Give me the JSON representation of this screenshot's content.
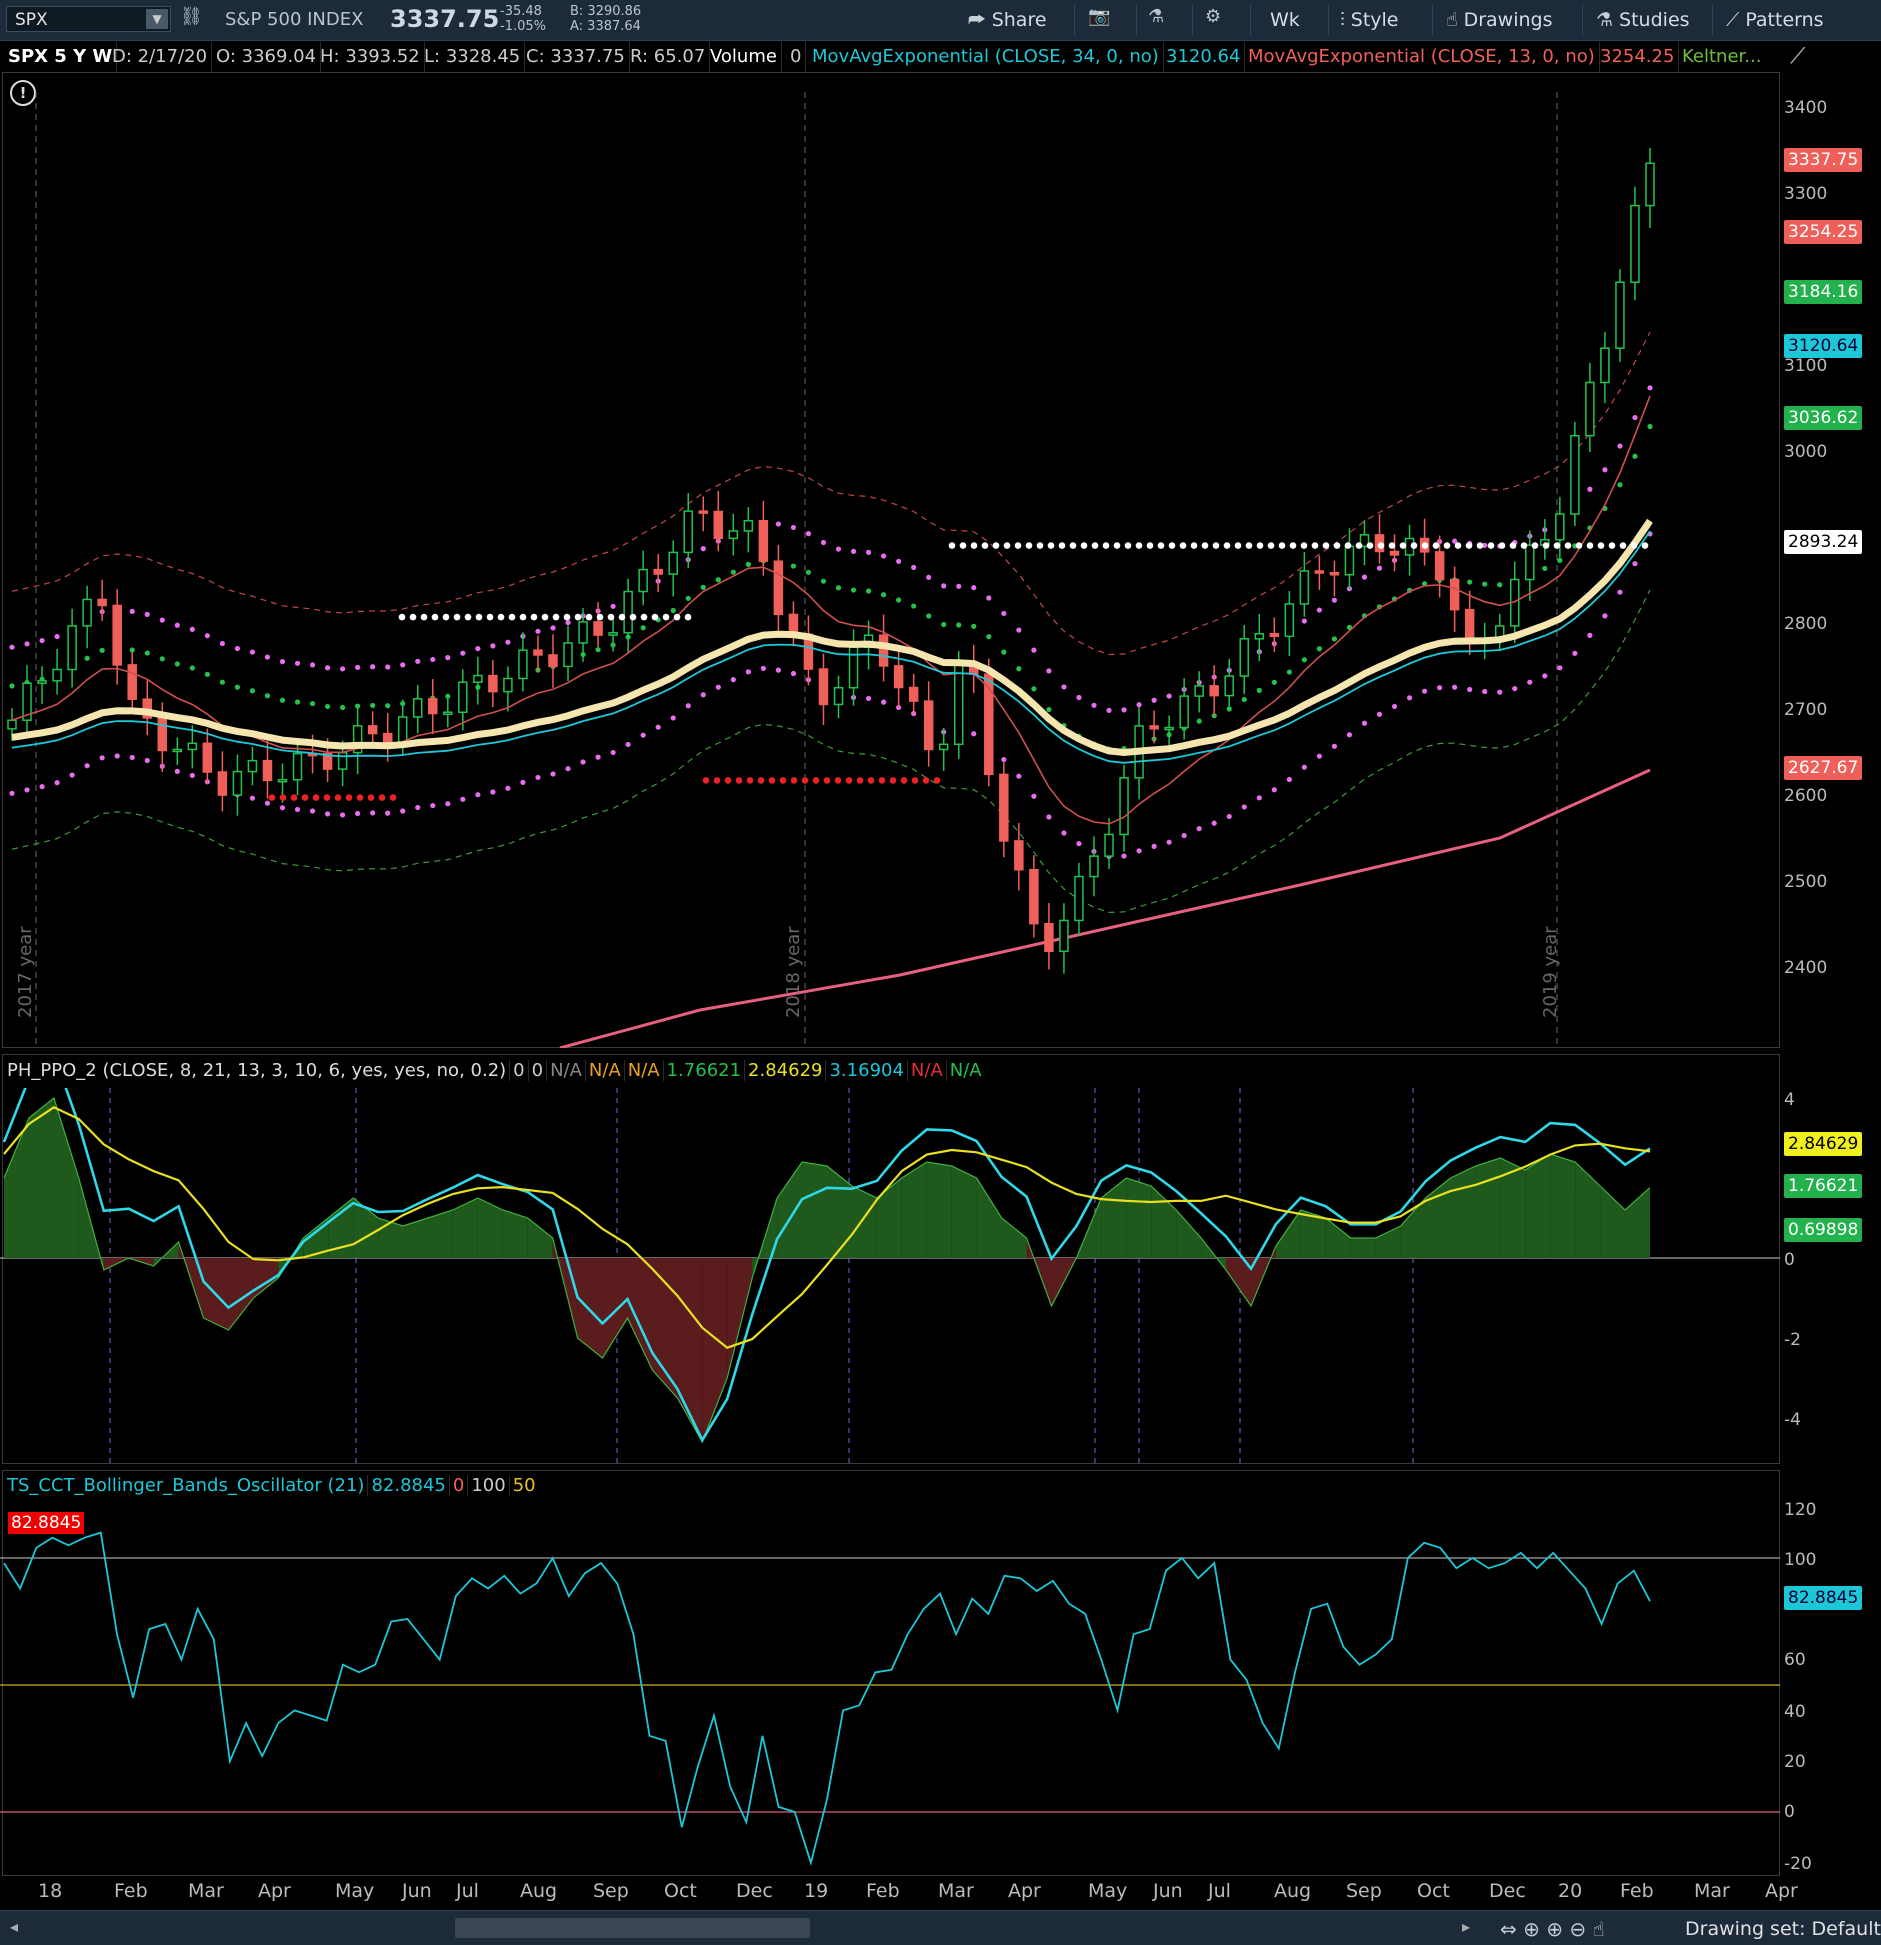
{
  "toolbar": {
    "symbol": "SPX",
    "name": "S&P 500 INDEX",
    "last": "3337.75",
    "change": "-35.48",
    "change_pct": "-1.05%",
    "bid": "B: 3290.86",
    "ask": "A: 3387.64",
    "share": "Share",
    "interval": "Wk",
    "style": "Style",
    "drawings": "Drawings",
    "studies": "Studies",
    "patterns": "Patterns"
  },
  "info": {
    "title": "SPX 5 Y W",
    "date": "D: 2/17/20",
    "open": "O: 3369.04",
    "high": "H: 3393.52",
    "low": "L: 3328.45",
    "close": "C: 3337.75",
    "range": "R: 65.07",
    "volume_label": "Volume",
    "volume_value": "0",
    "ema34": "MovAvgExponential (CLOSE, 34, 0, no)",
    "ema34_value": "3120.64",
    "ema13": "MovAvgExponential (CLOSE, 13, 0, no)",
    "ema13_value": "3254.25",
    "keltner": "Keltner..."
  },
  "price_axis": [
    "3400",
    "3300",
    "3100",
    "3000",
    "2800",
    "2700",
    "2600",
    "2500",
    "2400"
  ],
  "price_tags": [
    {
      "v": "3337.75",
      "bg": "#f0605a",
      "fg": "#fff"
    },
    {
      "v": "3254.25",
      "bg": "#f0605a",
      "fg": "#fff"
    },
    {
      "v": "3184.16",
      "bg": "#22b14c",
      "fg": "#fff"
    },
    {
      "v": "3120.64",
      "bg": "#1cc8d8",
      "fg": "#003"
    },
    {
      "v": "3036.62",
      "bg": "#22b14c",
      "fg": "#fff"
    },
    {
      "v": "2893.24",
      "bg": "#ffffff",
      "fg": "#000"
    },
    {
      "v": "2627.67",
      "bg": "#f0605a",
      "fg": "#fff"
    }
  ],
  "year_marks": [
    "2017 year",
    "2018 year",
    "2019 year"
  ],
  "ppo": {
    "name": "PH_PPO_2 (CLOSE, 8, 21, 13, 3, 10, 6, yes, yes, no, 0.2)",
    "v1": "0",
    "v2": "0",
    "v3": "N/A",
    "v4": "N/A",
    "v5": "N/A",
    "v6": "1.76621",
    "v7": "2.84629",
    "v8": "3.16904",
    "v9": "N/A",
    "v10": "N/A",
    "axis": [
      "4",
      "0",
      "-2",
      "-4"
    ],
    "tags": [
      {
        "v": "2.84629",
        "bg": "#f0f020",
        "fg": "#000"
      },
      {
        "v": "1.76621",
        "bg": "#22b14c",
        "fg": "#fff"
      },
      {
        "v": "0.69898",
        "bg": "#22b14c",
        "fg": "#fff"
      }
    ]
  },
  "bbo": {
    "name": "TS_CCT_Bollinger_Bands_Oscillator (21)",
    "value": "82.8845",
    "v2": "0",
    "v3": "100",
    "v4": "50",
    "axis": [
      "120",
      "100",
      "60",
      "40",
      "20",
      "0",
      "-20"
    ],
    "tag": "82.8845",
    "left_tag": "82.8845"
  },
  "x_axis": [
    "18",
    "Feb",
    "Mar",
    "Apr",
    "May",
    "Jun",
    "Jul",
    "Aug",
    "Sep",
    "Oct",
    "Dec",
    "19",
    "Feb",
    "Mar",
    "Apr",
    "May",
    "Jun",
    "Jul",
    "Aug",
    "Sep",
    "Oct",
    "Dec",
    "20",
    "Feb",
    "Mar",
    "Apr"
  ],
  "bottom": {
    "drawing_set": "Drawing set: Default"
  },
  "colors": {
    "up": "#22b14c",
    "down": "#f0605a",
    "ema34": "#1cc8d8",
    "thick": "#f5e6b0",
    "keltner": "#6b8e23"
  },
  "chart_data": {
    "type": "candlestick",
    "xlabel": "",
    "ylabel": "",
    "ylim": [
      2320,
      3450
    ],
    "ema_long_end": 2627.67,
    "support_levels": [
      2893.24,
      2810,
      2620,
      2600
    ]
  }
}
